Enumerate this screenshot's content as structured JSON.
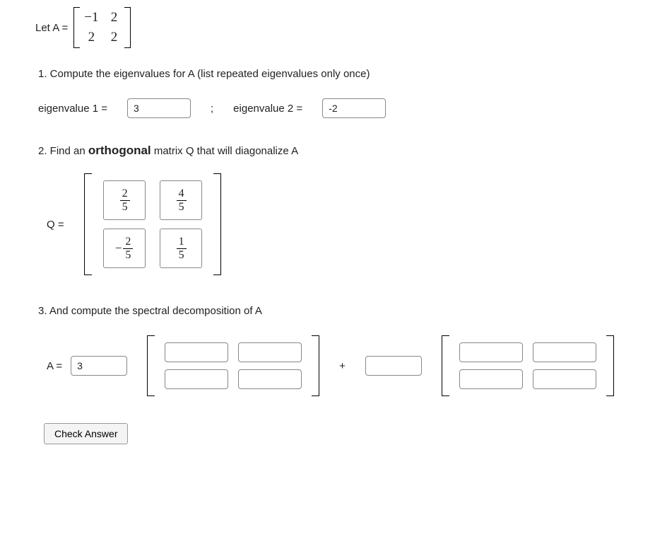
{
  "intro": {
    "let": "Let A ="
  },
  "matrixA": {
    "r1c1": "−1",
    "r1c2": "2",
    "r2c1": "2",
    "r2c2": "2"
  },
  "p1": {
    "prompt": "1. Compute the eigenvalues for A (list repeated eigenvalues only once)",
    "ev1_label": "eigenvalue 1 =",
    "ev1_value": "3",
    "sep": ";",
    "ev2_label": "eigenvalue 2 =",
    "ev2_value": "-2"
  },
  "p2": {
    "prompt_a": "2. Find an ",
    "prompt_b": "orthogonal",
    "prompt_c": " matrix Q that will diagonalize A",
    "q_label": "Q =",
    "cells": {
      "c11": {
        "sign": "",
        "num": "2",
        "den": "5"
      },
      "c12": {
        "sign": "",
        "num": "4",
        "den": "5"
      },
      "c21": {
        "sign": "−",
        "num": "2",
        "den": "5"
      },
      "c22": {
        "sign": "",
        "num": "1",
        "den": "5"
      }
    }
  },
  "p3": {
    "prompt": "3. And compute the spectral decomposition of A",
    "a_label": "A =",
    "scalar1": "3",
    "plus": "+",
    "scalar2": "",
    "m1": {
      "c11": "",
      "c12": "",
      "c21": "",
      "c22": ""
    },
    "m2": {
      "c11": "",
      "c12": "",
      "c21": "",
      "c22": ""
    }
  },
  "button": {
    "check": "Check Answer"
  }
}
